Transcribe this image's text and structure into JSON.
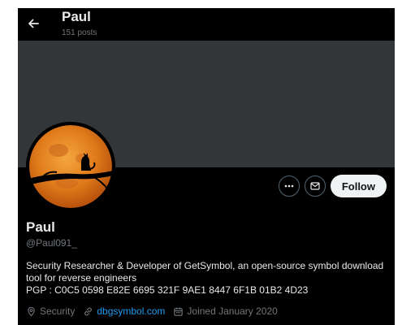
{
  "header": {
    "name": "Paul",
    "posts_count": "151 posts"
  },
  "profile": {
    "display_name": "Paul",
    "handle": "@Paul091_",
    "bio_lines": [
      "Security Researcher & Developer of GetSymbol, an open-source symbol download",
      "tool for reverse engineers",
      "PGP : C0C5 0598 E82E 6695 321F 9AE1 8447 6F1B 01B2 4D23"
    ],
    "location": "Security",
    "website": "dbgsymbol.com",
    "joined": "Joined January 2020"
  },
  "actions": {
    "follow_label": "Follow"
  },
  "icons": {
    "back": "arrow-left-icon",
    "more": "more-horizontal-icon",
    "message": "envelope-icon",
    "location": "location-pin-icon",
    "link": "link-icon",
    "calendar": "calendar-icon"
  },
  "colors": {
    "background": "#000000",
    "banner": "#333639",
    "text_primary": "#e7e9ea",
    "text_secondary": "#71767b",
    "link": "#1d9bf0",
    "follow_button_bg": "#eff3f4",
    "avatar_moon": "#e07a1a"
  }
}
